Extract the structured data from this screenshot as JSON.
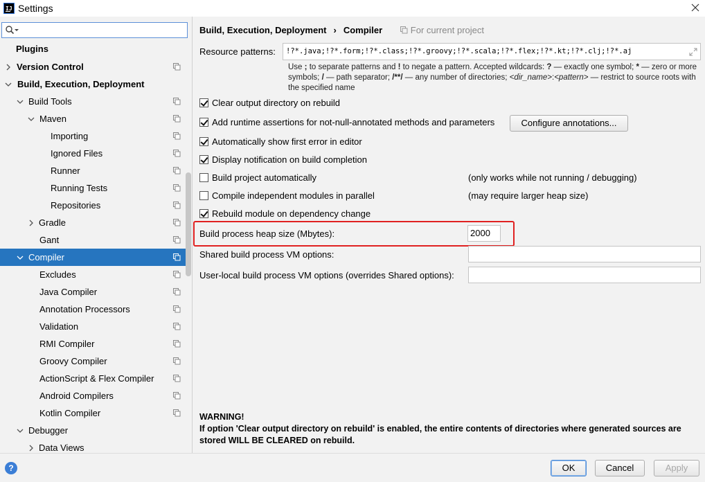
{
  "window": {
    "title": "Settings",
    "app_icon_text": "IJ"
  },
  "sidebar": {
    "search": {
      "value": "",
      "placeholder": ""
    },
    "items": [
      {
        "label": "Plugins"
      },
      {
        "label": "Version Control"
      },
      {
        "label": "Build, Execution, Deployment"
      },
      {
        "label": "Build Tools"
      },
      {
        "label": "Maven"
      },
      {
        "label": "Importing"
      },
      {
        "label": "Ignored Files"
      },
      {
        "label": "Runner"
      },
      {
        "label": "Running Tests"
      },
      {
        "label": "Repositories"
      },
      {
        "label": "Gradle"
      },
      {
        "label": "Gant"
      },
      {
        "label": "Compiler"
      },
      {
        "label": "Excludes"
      },
      {
        "label": "Java Compiler"
      },
      {
        "label": "Annotation Processors"
      },
      {
        "label": "Validation"
      },
      {
        "label": "RMI Compiler"
      },
      {
        "label": "Groovy Compiler"
      },
      {
        "label": "ActionScript & Flex Compiler"
      },
      {
        "label": "Android Compilers"
      },
      {
        "label": "Kotlin Compiler"
      },
      {
        "label": "Debugger"
      },
      {
        "label": "Data Views"
      }
    ]
  },
  "breadcrumb": {
    "parent": "Build, Execution, Deployment",
    "separator": "›",
    "current": "Compiler",
    "scope": "For current project"
  },
  "resource_patterns": {
    "label": "Resource patterns:",
    "value": "!?*.java;!?*.form;!?*.class;!?*.groovy;!?*.scala;!?*.flex;!?*.kt;!?*.clj;!?*.aj",
    "hint": {
      "p1": "Use ",
      "semicolon": ";",
      "p2": " to separate patterns and ",
      "bang": "!",
      "p3": " to negate a pattern. Accepted wildcards: ",
      "q": "?",
      "p4": " — exactly one symbol; ",
      "star": "*",
      "p5": " — zero or more symbols; ",
      "slash": "/",
      "p6": " — path separator; ",
      "dstar": "/**/",
      "p7": " — any number of directories; ",
      "dirname": "<dir_name>",
      "colon": ":",
      "pattern": "<pattern>",
      "p8": " — restrict to source roots with the specified name"
    }
  },
  "options": [
    {
      "label": "Clear output directory on rebuild",
      "checked": true
    },
    {
      "label": "Add runtime assertions for not-null-annotated methods and parameters",
      "checked": true
    },
    {
      "label": "Automatically show first error in editor",
      "checked": true
    },
    {
      "label": "Display notification on build completion",
      "checked": true
    },
    {
      "label": "Build project automatically",
      "checked": false,
      "note": "(only works while not running / debugging)"
    },
    {
      "label": "Compile independent modules in parallel",
      "checked": false,
      "note": "(may require larger heap size)"
    },
    {
      "label": "Rebuild module on dependency change",
      "checked": true
    }
  ],
  "configure_annotations_label": "Configure annotations...",
  "heap": {
    "label": "Build process heap size (Mbytes):",
    "value": "2000"
  },
  "shared_vm": {
    "label": "Shared build process VM options:",
    "value": ""
  },
  "user_vm": {
    "label": "User-local build process VM options (overrides Shared options):",
    "value": ""
  },
  "warning": {
    "title": "WARNING!",
    "text": "If option 'Clear output directory on rebuild' is enabled, the entire contents of directories where generated sources are stored WILL BE CLEARED on rebuild."
  },
  "footer": {
    "help": "?",
    "ok": "OK",
    "cancel": "Cancel",
    "apply": "Apply"
  },
  "colors": {
    "selection": "#2675bf",
    "highlight_border": "#e02020",
    "help_icon": "#3b7ed6"
  }
}
